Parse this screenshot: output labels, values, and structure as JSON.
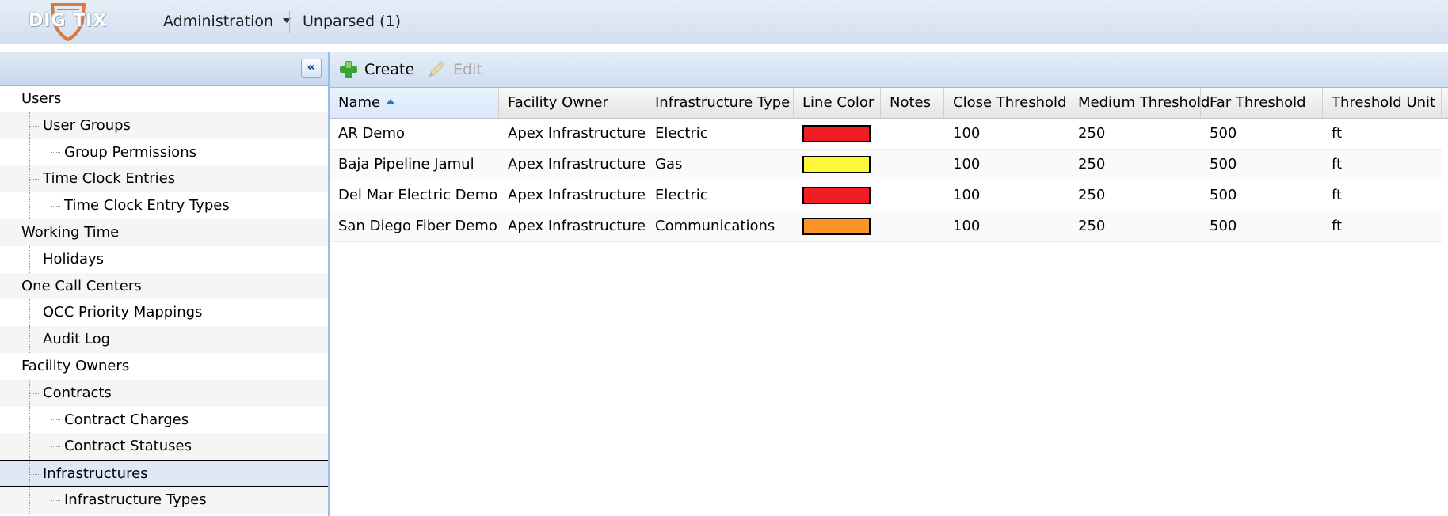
{
  "logo": {
    "text": "DIG TIX"
  },
  "header": {
    "admin_menu": "Administration",
    "unparsed": "Unparsed (1)"
  },
  "sidebar": {
    "collapse_label": "«",
    "items": [
      {
        "label": "Users",
        "level": 0
      },
      {
        "label": "User Groups",
        "level": 1
      },
      {
        "label": "Group Permissions",
        "level": 2
      },
      {
        "label": "Time Clock Entries",
        "level": 1
      },
      {
        "label": "Time Clock Entry Types",
        "level": 2
      },
      {
        "label": "Working Time",
        "level": 0
      },
      {
        "label": "Holidays",
        "level": 1
      },
      {
        "label": "One Call Centers",
        "level": 0
      },
      {
        "label": "OCC Priority Mappings",
        "level": 1
      },
      {
        "label": "Audit Log",
        "level": 1
      },
      {
        "label": "Facility Owners",
        "level": 0
      },
      {
        "label": "Contracts",
        "level": 1
      },
      {
        "label": "Contract Charges",
        "level": 2
      },
      {
        "label": "Contract Statuses",
        "level": 2
      },
      {
        "label": "Infrastructures",
        "level": 1,
        "selected": true
      },
      {
        "label": "Infrastructure Types",
        "level": 2
      }
    ]
  },
  "toolbar": {
    "create_label": "Create",
    "edit_label": "Edit",
    "edit_disabled": true
  },
  "grid": {
    "columns": [
      "Name",
      "Facility Owner",
      "Infrastructure Type",
      "Line Color",
      "Notes",
      "Close Threshold",
      "Medium Threshold",
      "Far Threshold",
      "Threshold Unit"
    ],
    "sorted_column": "Name",
    "sort_direction": "asc",
    "rows": [
      {
        "name": "AR Demo",
        "owner": "Apex Infrastructure",
        "type": "Electric",
        "color": "#f01e24",
        "notes": "",
        "close": "100",
        "medium": "250",
        "far": "500",
        "unit": "ft"
      },
      {
        "name": "Baja Pipeline Jamul",
        "owner": "Apex Infrastructure",
        "type": "Gas",
        "color": "#fff838",
        "notes": "",
        "close": "100",
        "medium": "250",
        "far": "500",
        "unit": "ft"
      },
      {
        "name": "Del Mar Electric Demo",
        "owner": "Apex Infrastructure",
        "type": "Electric",
        "color": "#f01e24",
        "notes": "",
        "close": "100",
        "medium": "250",
        "far": "500",
        "unit": "ft"
      },
      {
        "name": "San Diego Fiber Demo",
        "owner": "Apex Infrastructure",
        "type": "Communications",
        "color": "#fb9428",
        "notes": "",
        "close": "100",
        "medium": "250",
        "far": "500",
        "unit": "ft"
      }
    ]
  },
  "colors": {
    "accent": "#99bbe8",
    "create_green": "#3aa335",
    "logo_orange": "#d9793a"
  }
}
